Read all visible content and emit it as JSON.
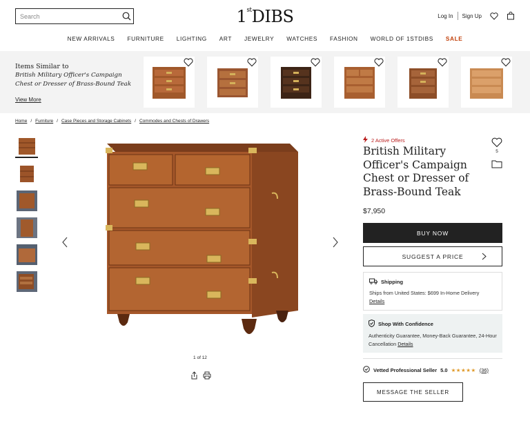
{
  "header": {
    "search_placeholder": "Search",
    "logo_main": "DIBS",
    "logo_num": "1",
    "logo_sup": "st",
    "login": "Log In",
    "signup": "Sign Up"
  },
  "nav": [
    "NEW ARRIVALS",
    "FURNITURE",
    "LIGHTING",
    "ART",
    "JEWELRY",
    "WATCHES",
    "FASHION",
    "WORLD OF 1STDIBS",
    "SALE"
  ],
  "similar": {
    "heading": "Items Similar to",
    "item_title": "British Military Officer's Campaign Chest or Dresser of Brass-Bound Teak",
    "view_more": "View More"
  },
  "breadcrumb": [
    "Home",
    "Furniture",
    "Case Pieces and Storage Cabinets",
    "Commodes and Chests of Drawers"
  ],
  "gallery": {
    "counter": "1 of 12"
  },
  "product": {
    "offers": "2 Active Offers",
    "title": "British Military Officer's Campaign Chest or Dresser of Brass-Bound Teak",
    "favorites_count": "5",
    "price": "$7,950",
    "buy_label": "BUY NOW",
    "suggest_label": "SUGGEST A PRICE"
  },
  "shipping": {
    "heading": "Shipping",
    "text": "Ships from United States: $699 In-Home Delivery",
    "link": "Details"
  },
  "confidence": {
    "heading": "Shop With Confidence",
    "text": "Authenticity Guarantee, Money-Back Guarantee, 24-Hour Cancellation",
    "link": "Details"
  },
  "seller": {
    "label": "Vetted Professional Seller",
    "rating": "5.0",
    "stars": "★★★★★",
    "reviews": "(36)",
    "message_label": "MESSAGE THE SELLER"
  },
  "colors": {
    "sale": "#c2410c",
    "offers": "#b91c1c",
    "wood": "#a0582a",
    "brass": "#d4b15a"
  }
}
